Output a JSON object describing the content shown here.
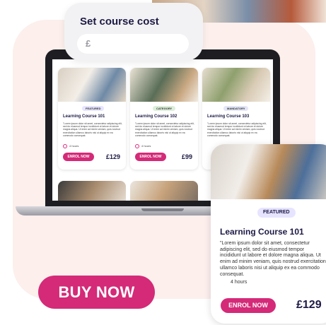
{
  "cost_popup": {
    "title": "Set course cost",
    "currency_symbol": "£"
  },
  "laptop_screen": {
    "cards": [
      {
        "badge": "FEATURED",
        "title": "Learning Course 101",
        "description": "\"Lorem ipsum dolor sit amet, consectetur adipiscing elit, sed do eiusmod tempor incididunt ut labore et dolore magna aliqua. Ut enim ad minim veniam, quis nostrud exercitation ullamco laboris nisi ut aliquip ex ea commodo consequat.",
        "hours": "4 hours",
        "button_label": "ENROL NOW",
        "price": "£129"
      },
      {
        "badge": "CATEGORY",
        "title": "Learning Course 102",
        "description": "\"Lorem ipsum dolor sit amet, consectetur adipiscing elit, sed do eiusmod tempor incididunt ut labore et dolore magna aliqua. Ut enim ad minim veniam, quis nostrud exercitation ullamco laboris nisi ut aliquip ex ea commodo consequat.",
        "hours": "4 hours",
        "button_label": "ENROL NOW",
        "price": "£99"
      },
      {
        "badge": "MANDATORY",
        "title": "Learning Course 103",
        "description": "\"Lorem ipsum dolor sit amet, consectetur adipiscing elit, sed do eiusmod tempor incididunt ut labore et dolore magna aliqua. Ut enim ad minim veniam, quis nostrud exercitation ullamco laboris nisi ut aliquip ex ea commodo consequat."
      }
    ]
  },
  "featured_card": {
    "badge": "FEATURED",
    "title": "Learning Course 101",
    "description": "\"Lorem ipsum dolor sit amet, consectetur adipiscing elit, sed do eiusmod tempor incididunt ut labore et dolore magna aliqua. Ut enim ad minim veniam, quis nostrud exercitation ullamco laboris nisi ut aliquip ex ea commodo consequat.",
    "hours": "4 hours",
    "button_label": "ENROL NOW",
    "price": "£129"
  },
  "buy_button": {
    "label": "BUY NOW"
  },
  "colors": {
    "accent": "#d42a78",
    "heading": "#1d1a45",
    "background_blob": "#fcefec",
    "featured_badge": "#e6e4ff",
    "category_badge": "#dcefd9",
    "mandatory_badge": "#e3e6f7"
  }
}
